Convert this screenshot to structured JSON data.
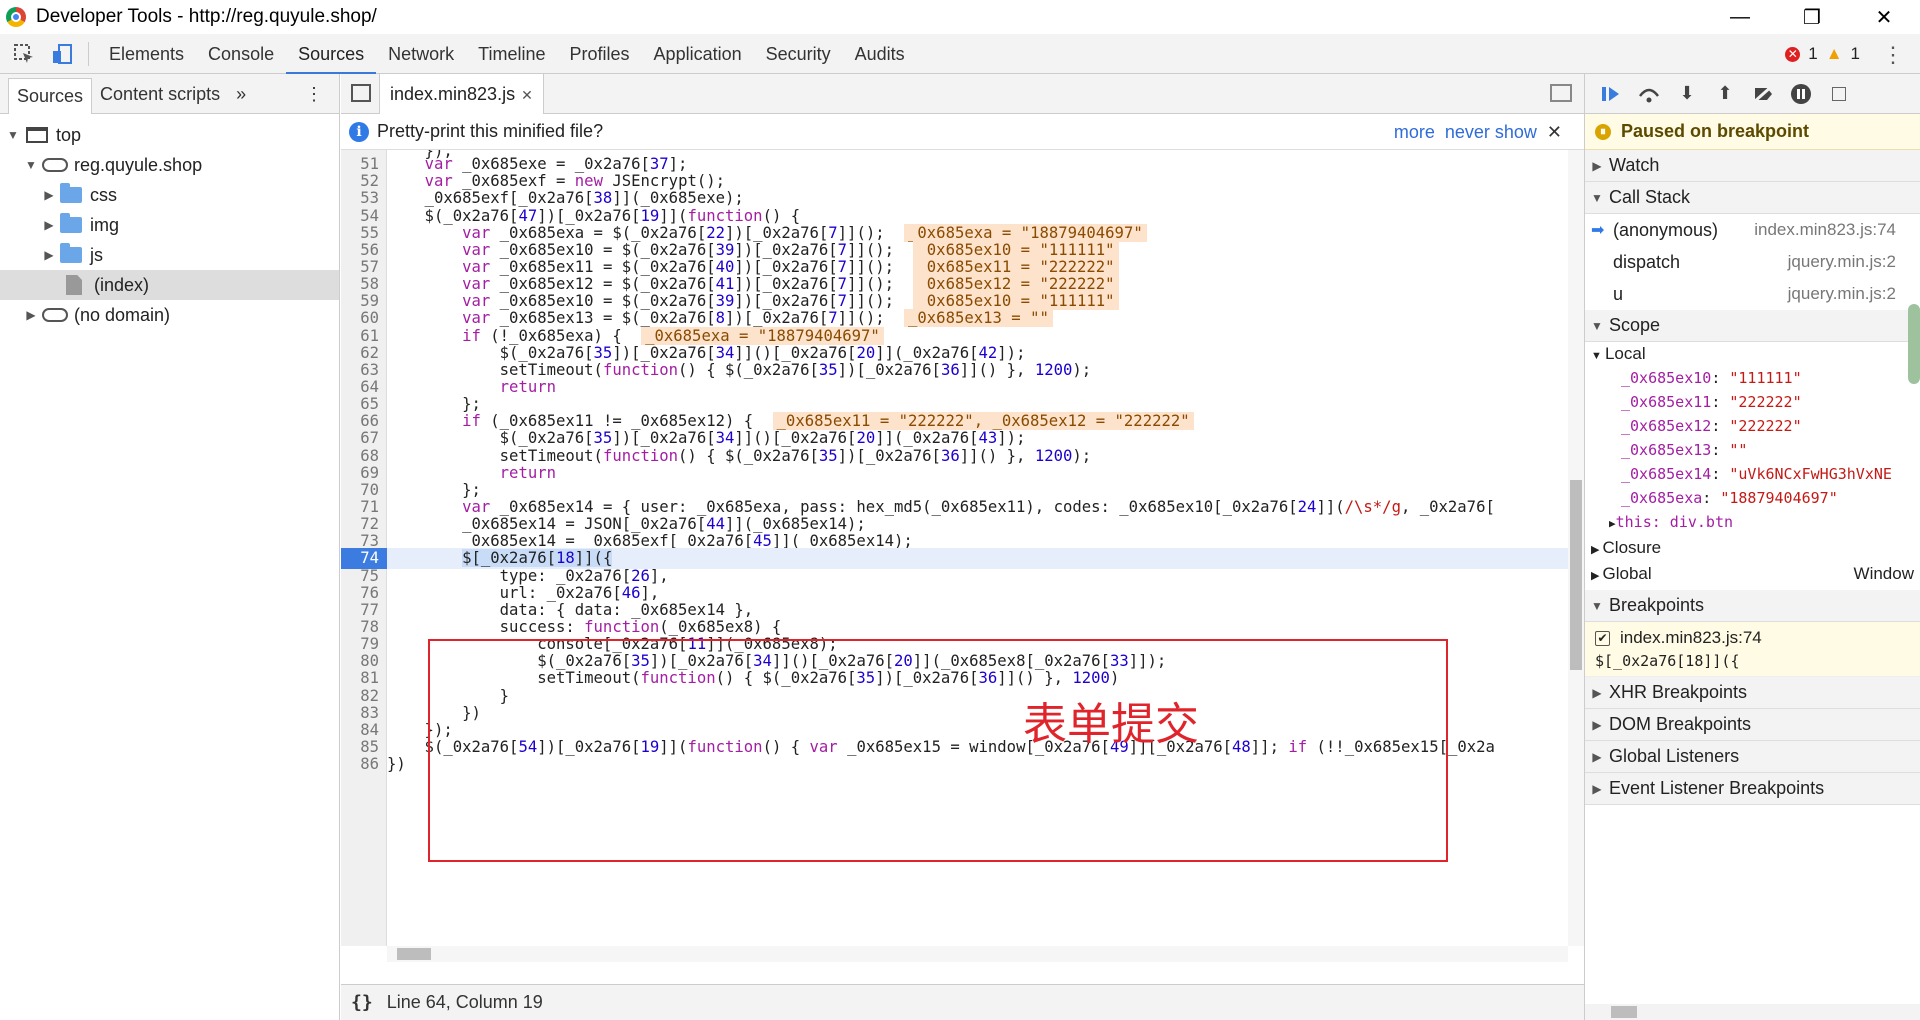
{
  "window": {
    "title": "Developer Tools - http://reg.quyule.shop/"
  },
  "main_tabs": [
    "Elements",
    "Console",
    "Sources",
    "Network",
    "Timeline",
    "Profiles",
    "Application",
    "Security",
    "Audits"
  ],
  "status": {
    "errors": "1",
    "warnings": "1"
  },
  "left": {
    "tabs": [
      "Sources",
      "Content scripts"
    ],
    "tree": [
      "top",
      "reg.quyule.shop",
      "css",
      "img",
      "js",
      "(index)",
      "(no domain)"
    ]
  },
  "editor": {
    "file_tab": "index.min823.js",
    "info": "Pretty-print this minified file?",
    "info_more": "more",
    "info_never": "never show",
    "annotation": "表单提交",
    "status": "Line 64, Column 19",
    "braces": "{}"
  },
  "right": {
    "paused": "Paused on breakpoint",
    "sections": {
      "watch": "Watch",
      "callstack": "Call Stack",
      "scope": "Scope",
      "breakpoints": "Breakpoints",
      "xhr": "XHR Breakpoints",
      "dom": "DOM Breakpoints",
      "global": "Global Listeners",
      "event": "Event Listener Breakpoints"
    },
    "callstack": [
      {
        "fn": "(anonymous)",
        "loc": "index.min823.js:74"
      },
      {
        "fn": "dispatch",
        "loc": "jquery.min.js:2"
      },
      {
        "fn": "u",
        "loc": "jquery.min.js:2"
      }
    ],
    "scope_local": "Local",
    "scope_vars": [
      {
        "name": "_0x685ex10",
        "val": "\"111111\""
      },
      {
        "name": "_0x685ex11",
        "val": "\"222222\""
      },
      {
        "name": "_0x685ex12",
        "val": "\"222222\""
      },
      {
        "name": "_0x685ex13",
        "val": "\"\""
      },
      {
        "name": "_0x685ex14",
        "val": "\"uVk6NCxFwHG3hVxNE"
      },
      {
        "name": "_0x685exa",
        "val": "\"18879404697\""
      }
    ],
    "scope_this": "this: div.btn",
    "closure": "Closure",
    "global_scope": "Global",
    "global_val": "Window",
    "breakpoint": {
      "loc": "index.min823.js:74",
      "code": "$[_0x2a76[18]]({"
    }
  }
}
